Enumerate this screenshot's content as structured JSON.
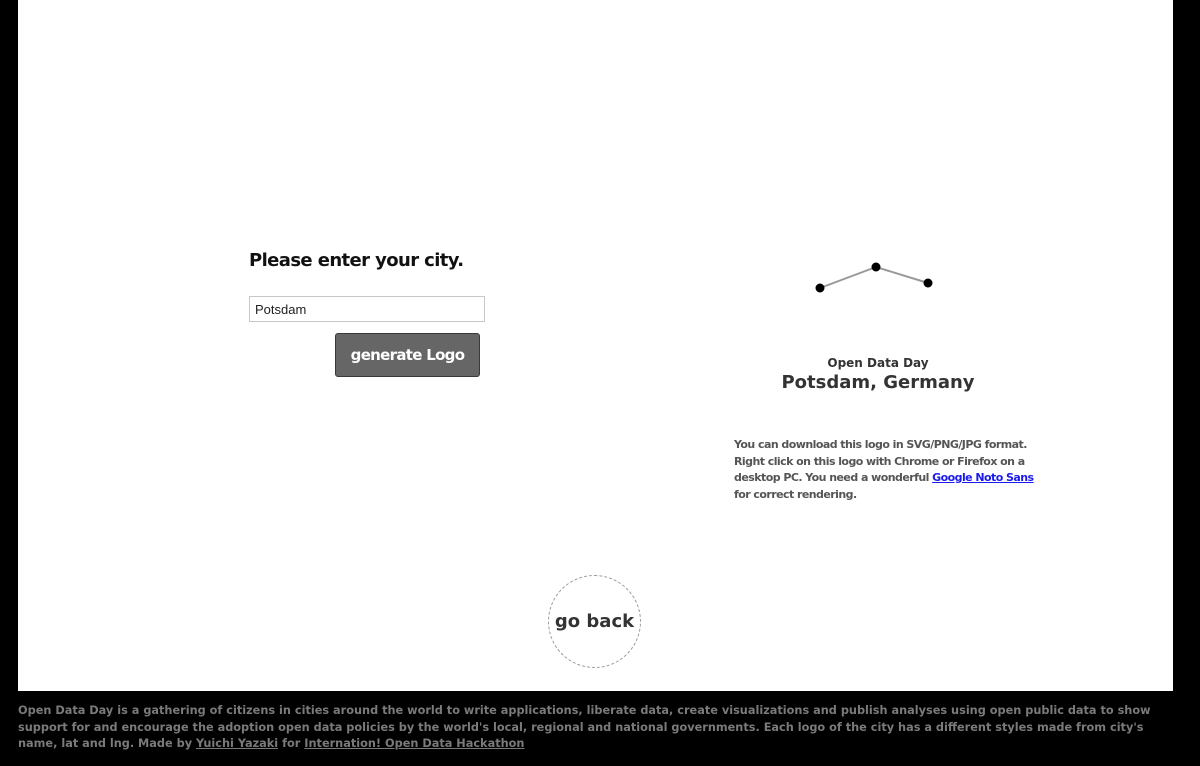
{
  "form": {
    "prompt": "Please enter your city.",
    "city_value": "Potsdam",
    "generate_label": "generate Logo"
  },
  "logo": {
    "subtitle": "Open Data Day",
    "city_label": "Potsdam, Germany",
    "stroke_color": "#999999",
    "dot_color": "#000000"
  },
  "download_note": {
    "text_before": "You can download this logo in SVG/PNG/JPG format. Right click on this logo with Chrome or Firefox on a desktop PC. You need a wonderful ",
    "link_label": "Google Noto Sans",
    "text_after": " for correct rendering."
  },
  "go_back": {
    "label": "go back"
  },
  "footer": {
    "text_before": "Open Data Day is a gathering of citizens in cities around the world to write applications, liberate data, create visualizations and publish analyses using open public data to show support for and encourage the adoption open data policies by the world's local, regional and national governments. Each logo of the city has a different styles made from city's name, lat and lng. Made by ",
    "author_link": "Yuichi Yazaki",
    "middle": " for ",
    "hackathon_link": "Internation! Open Data Hackathon"
  },
  "colors": {
    "page_background": "#ffffff",
    "frame_background": "#000000",
    "button_background": "#666666",
    "link_color": "#1a1aee"
  }
}
